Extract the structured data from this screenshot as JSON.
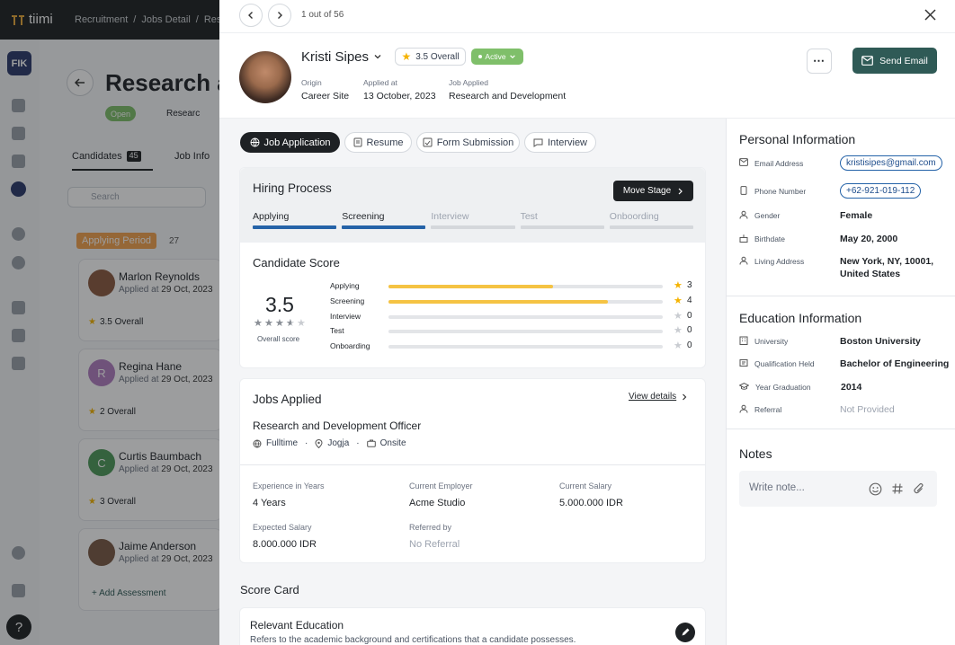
{
  "app": {
    "logo": "tiimi",
    "breadcrumb": [
      "Recruitment",
      "Jobs Detail",
      "Rese"
    ],
    "org_badge": "FIK"
  },
  "background": {
    "page_title": "Research ar",
    "status": "Open",
    "department": "Researc",
    "tabs": [
      {
        "label": "Candidates",
        "count": "45"
      },
      {
        "label": "Job Info"
      }
    ],
    "search_placeholder": "Search",
    "column": {
      "title": "Applying Period",
      "count": "27"
    },
    "candidates": [
      {
        "name": "Marlon Reynolds",
        "applied_prefix": "Applied at",
        "applied": "29 Oct, 2023",
        "rating": "3.5 Overall",
        "initial": ""
      },
      {
        "name": "Regina Hane",
        "applied_prefix": "Applied at",
        "applied": "29 Oct, 2023",
        "rating": "2 Overall",
        "initial": "R"
      },
      {
        "name": "Curtis Baumbach",
        "applied_prefix": "Applied at",
        "applied": "29 Oct, 2023",
        "rating": "3 Overall",
        "initial": "C"
      },
      {
        "name": "Jaime Anderson",
        "applied_prefix": "Applied at",
        "applied": "29 Oct, 2023",
        "rating": "",
        "initial": ""
      }
    ],
    "add_assessment": "Add Assessment"
  },
  "drawer": {
    "pager": "1 out of 56",
    "candidate": {
      "name": "Kristi Sipes",
      "overall": "3.5 Overall",
      "status": "Active",
      "origin_label": "Origin",
      "origin": "Career Site",
      "applied_label": "Applied at",
      "applied": "13 October, 2023",
      "job_label": "Job Applied",
      "job": "Research and Development"
    },
    "send_email": "Send Email",
    "tabs": [
      "Job Application",
      "Resume",
      "Form Submission",
      "Interview"
    ],
    "hiring": {
      "title": "Hiring Process",
      "move_stage": "Move Stage",
      "stages": [
        "Applying",
        "Screening",
        "Interview",
        "Test",
        "Onboording"
      ],
      "completed_stages": 2
    },
    "score": {
      "title": "Candidate Score",
      "overall": "3.5",
      "overall_label": "Overall score",
      "stars": 3.5,
      "max": 5,
      "rows": [
        {
          "label": "Applying",
          "value": 3
        },
        {
          "label": "Screening",
          "value": 4
        },
        {
          "label": "Interview",
          "value": 0
        },
        {
          "label": "Test",
          "value": 0
        },
        {
          "label": "Onboarding",
          "value": 0
        }
      ]
    },
    "jobs": {
      "title": "Jobs Applied",
      "view_details": "View details",
      "position": "Research and Development Officer",
      "type": "Fulltime",
      "location": "Jogja",
      "mode": "Onsite",
      "fields": [
        {
          "label": "Experience in Years",
          "value": "4 Years"
        },
        {
          "label": "Current Employer",
          "value": "Acme Studio"
        },
        {
          "label": "Current Salary",
          "value": "5.000.000 IDR"
        },
        {
          "label": "Expected Salary",
          "value": "8.000.000 IDR"
        },
        {
          "label": "Referred by",
          "value": "No Referral"
        }
      ]
    },
    "scorecard": {
      "title": "Score Card",
      "item_title": "Relevant Education",
      "item_desc": "Refers to the academic background and certifications that a candidate possesses."
    },
    "personal": {
      "title": "Personal Information",
      "rows": [
        {
          "label": "Email Address",
          "value": "kristisipes@gmail.com"
        },
        {
          "label": "Phone Number",
          "value": "+62-921-019-112"
        },
        {
          "label": "Gender",
          "value": "Female"
        },
        {
          "label": "Birthdate",
          "value": "May 20, 2000"
        },
        {
          "label": "Living Address",
          "value": "New York, NY, 10001, United States"
        }
      ]
    },
    "education": {
      "title": "Education Information",
      "rows": [
        {
          "label": "University",
          "value": "Boston University"
        },
        {
          "label": "Qualification Held",
          "value": "Bachelor of Engineering"
        },
        {
          "label": "Year Graduation",
          "value": "2014"
        },
        {
          "label": "Referral",
          "value": "Not Provided"
        }
      ]
    },
    "notes": {
      "title": "Notes",
      "placeholder": "Write note..."
    }
  },
  "colors": {
    "accent": "#2f5a56",
    "star": "#f5b301",
    "stage_done": "#2563a8",
    "active_green": "#7fbf6a"
  }
}
